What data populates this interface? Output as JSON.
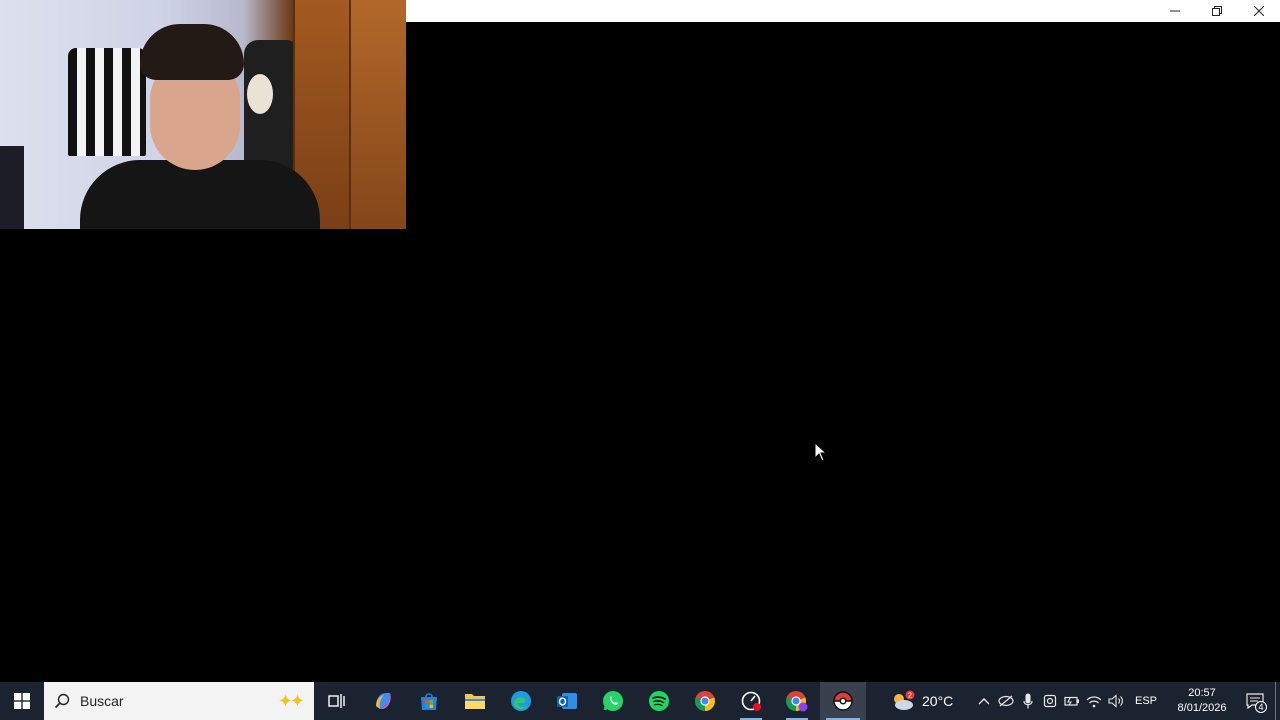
{
  "window": {
    "minimize_label": "minimize",
    "restore_label": "restore",
    "close_label": "close"
  },
  "taskbar": {
    "search": {
      "placeholder": "Buscar"
    },
    "apps": [
      {
        "name": "task-view-icon"
      },
      {
        "name": "copilot-icon"
      },
      {
        "name": "microsoft-store-icon"
      },
      {
        "name": "file-explorer-icon"
      },
      {
        "name": "edge-icon"
      },
      {
        "name": "outlook-icon"
      },
      {
        "name": "whatsapp-icon"
      },
      {
        "name": "spotify-icon"
      },
      {
        "name": "chrome-icon"
      },
      {
        "name": "recorder-icon"
      },
      {
        "name": "chrome-profile-icon"
      },
      {
        "name": "pokeball-app-icon"
      }
    ],
    "weather": {
      "temperature": "20°C",
      "badge": "2"
    },
    "tray": {
      "language": "ESP",
      "time": "20:57",
      "date": "8/01/2026",
      "notification_count": "4"
    }
  },
  "colors": {
    "taskbar_bg": "#1c2330",
    "accent": "#7fb3e6"
  }
}
